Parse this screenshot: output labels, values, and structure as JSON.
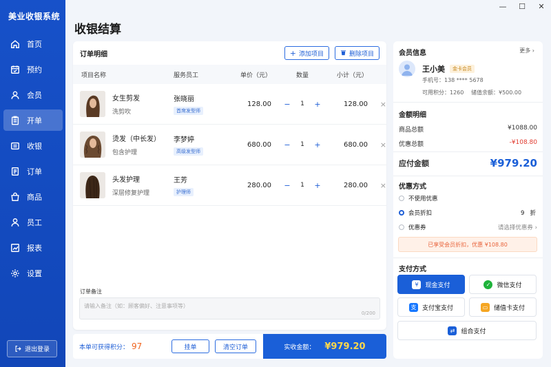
{
  "app": {
    "title": "美业收银系统"
  },
  "window": {
    "minimize": "—",
    "maximize": "☐",
    "close": "✕"
  },
  "nav": [
    {
      "label": "首页",
      "icon": "home-icon",
      "active": false
    },
    {
      "label": "预约",
      "icon": "calendar-icon",
      "active": false
    },
    {
      "label": "会员",
      "icon": "member-icon",
      "active": false
    },
    {
      "label": "开单",
      "icon": "clipboard-icon",
      "active": true
    },
    {
      "label": "收银",
      "icon": "cashier-icon",
      "active": false
    },
    {
      "label": "订单",
      "icon": "order-icon",
      "active": false
    },
    {
      "label": "商品",
      "icon": "goods-icon",
      "active": false
    },
    {
      "label": "员工",
      "icon": "staff-icon",
      "active": false
    },
    {
      "label": "报表",
      "icon": "report-icon",
      "active": false
    },
    {
      "label": "设置",
      "icon": "settings-icon",
      "active": false
    }
  ],
  "logout_label": "退出登录",
  "page_title": "收银结算",
  "order": {
    "title": "订单明细",
    "add_label": "添加项目",
    "delete_label": "删除项目",
    "columns": {
      "name": "项目名称",
      "staff": "服务员工",
      "price": "单价（元）",
      "qty": "数量",
      "subtotal": "小计（元）"
    },
    "items": [
      {
        "name": "女生剪发",
        "desc": "洗剪吹",
        "staff": "张晓丽",
        "staff_tag": "首席发型师",
        "price": "128.00",
        "qty": "1",
        "subtotal": "128.00"
      },
      {
        "name": "烫发（中长发）",
        "desc": "包含护理",
        "staff": "李梦婷",
        "staff_tag": "高级发型师",
        "price": "680.00",
        "qty": "1",
        "subtotal": "680.00"
      },
      {
        "name": "头发护理",
        "desc": "深层修复护理",
        "staff": "王芳",
        "staff_tag": "护理师",
        "price": "280.00",
        "qty": "1",
        "subtotal": "280.00"
      }
    ],
    "note_label": "订单备注",
    "note_placeholder": "请输入备注（如：顾客偏好、注意事项等）",
    "note_count": "0/200"
  },
  "bottom": {
    "points_label": "本单可获得积分：",
    "points_value": "97",
    "hold_label": "挂单",
    "clear_label": "清空订单",
    "pay_label": "实收金额：",
    "pay_amount": "¥979.20"
  },
  "member": {
    "title": "会员信息",
    "more_label": "更多 ›",
    "name": "王小美",
    "level": "金卡会员",
    "phone": "手机号：138 **** 5678",
    "points": "可用积分：1260",
    "balance": "储值余额：¥500.00"
  },
  "amount": {
    "title": "金额明细",
    "goods_label": "商品总额",
    "goods_value": "¥1088.00",
    "discount_label": "优惠总额",
    "discount_value": "-¥108.80",
    "payable_label": "应付金额",
    "payable_value": "¥979.20"
  },
  "discount": {
    "title": "优惠方式",
    "none_label": "不使用优惠",
    "member_label": "会员折扣",
    "member_rate": "9",
    "member_unit": "折",
    "coupon_label": "优惠券",
    "coupon_hint": "请选择优惠券",
    "notice": "已享受会员折扣，优惠 ¥108.80"
  },
  "payment": {
    "title": "支付方式",
    "cash": "现金支付",
    "wechat": "微信支付",
    "alipay": "支付宝支付",
    "card": "储值卡支付",
    "combo": "组合支付"
  },
  "colors": {
    "primary": "#1a5fd8",
    "sidebar": "#1751c9",
    "accent_orange": "#f0641e",
    "discount_red": "#e03a2f",
    "amount_yellow": "#ffd84a"
  }
}
